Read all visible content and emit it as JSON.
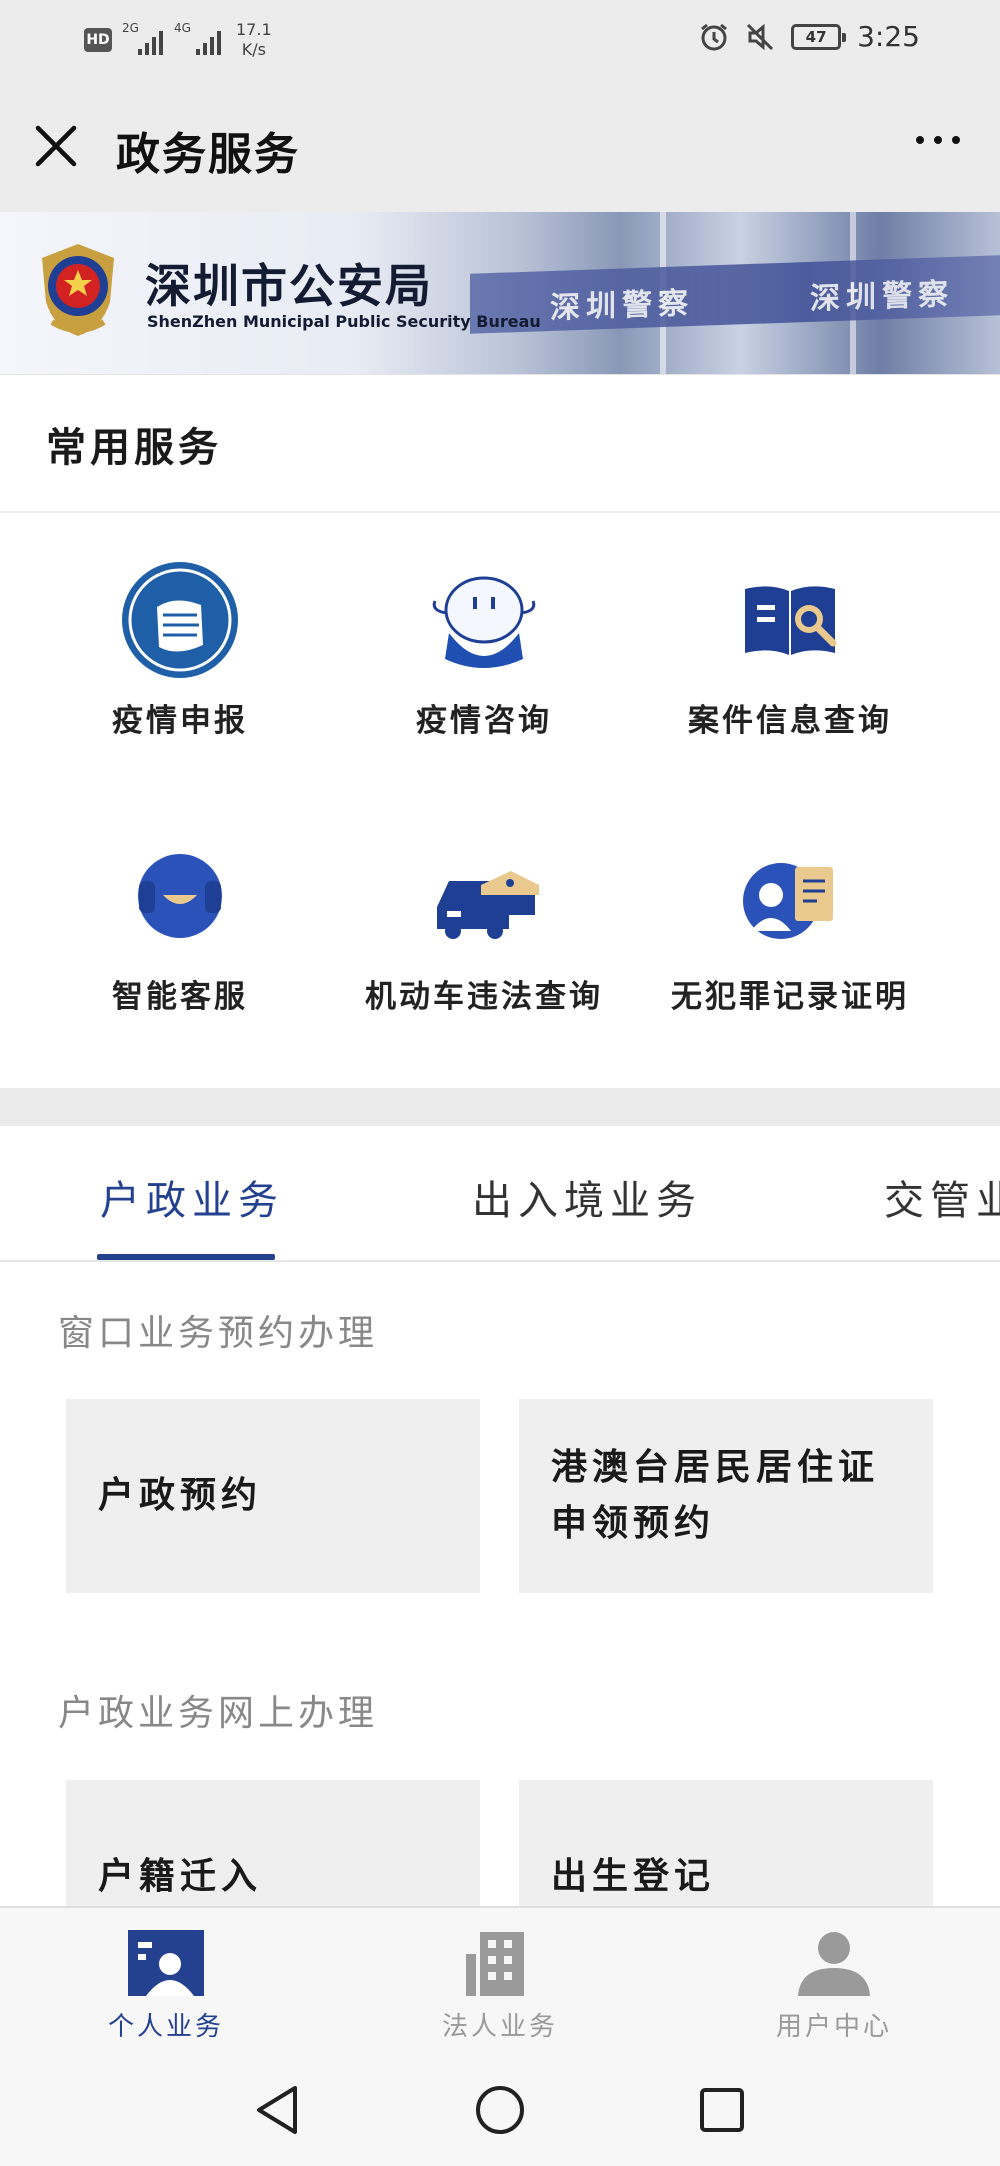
{
  "status_bar": {
    "hd": "HD",
    "sim1": "2G",
    "sim2": "4G",
    "speed_value": "17.1",
    "speed_unit": "K/s",
    "battery": "47",
    "time": "3:25"
  },
  "title_bar": {
    "title": "政务服务"
  },
  "banner": {
    "name": "深圳市公安局",
    "name_en": "ShenZhen Municipal Public Security Bureau",
    "sign_left": "深圳警察",
    "sign_right": "深圳警察"
  },
  "common_services": {
    "title": "常用服务",
    "items": [
      {
        "label": "疫情申报",
        "icon": "mask-icon"
      },
      {
        "label": "疫情咨询",
        "icon": "mascot-icon"
      },
      {
        "label": "案件信息查询",
        "icon": "book-search-icon"
      },
      {
        "label": "智能客服",
        "icon": "headset-icon"
      },
      {
        "label": "机动车违法查询",
        "icon": "car-police-icon"
      },
      {
        "label": "无犯罪记录证明",
        "icon": "certificate-icon"
      }
    ]
  },
  "tabs": {
    "items": [
      "户政业务",
      "出入境业务",
      "交管业务"
    ],
    "active": 0
  },
  "groups": [
    {
      "label": "窗口业务预约办理",
      "tiles": [
        "户政预约",
        "港澳台居民居住证申领预约"
      ]
    },
    {
      "label": "户政业务网上办理",
      "tiles": [
        "户籍迁入",
        "出生登记"
      ]
    }
  ],
  "bottom_nav": {
    "items": [
      "个人业务",
      "法人业务",
      "用户中心"
    ],
    "active": 0
  },
  "colors": {
    "accent": "#23418f",
    "icon_blue": "#1f3f94",
    "icon_gold": "#e9c98d",
    "tile_bg": "#efefef",
    "muted": "#9a9a9a"
  }
}
